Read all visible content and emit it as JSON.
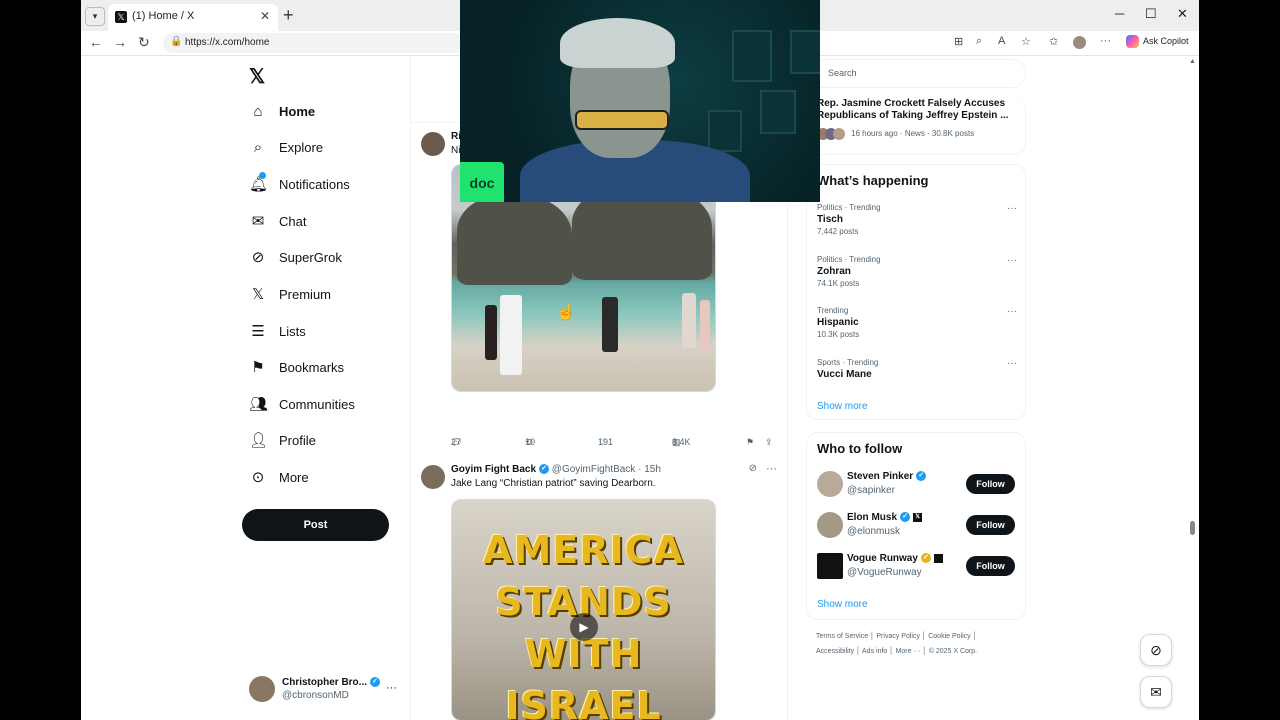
{
  "browser": {
    "tab_title": "(1) Home / X",
    "url": "https://x.com/home",
    "copilot_label": "Ask Copilot"
  },
  "nav": {
    "items": [
      {
        "label": "Home",
        "icon": "home-icon"
      },
      {
        "label": "Explore",
        "icon": "search-icon"
      },
      {
        "label": "Notifications",
        "icon": "bell-icon"
      },
      {
        "label": "Chat",
        "icon": "mail-icon"
      },
      {
        "label": "SuperGrok",
        "icon": "grok-icon"
      },
      {
        "label": "Premium",
        "icon": "x-icon"
      },
      {
        "label": "Lists",
        "icon": "list-icon"
      },
      {
        "label": "Bookmarks",
        "icon": "bookmark-icon"
      },
      {
        "label": "Communities",
        "icon": "people-icon"
      },
      {
        "label": "Profile",
        "icon": "person-icon"
      },
      {
        "label": "More",
        "icon": "more-circle-icon"
      }
    ],
    "post_label": "Post",
    "account": {
      "name": "Christopher Bro...",
      "handle": "@cbronsonMD"
    }
  },
  "feed": {
    "post1": {
      "name_prefix": "Ri",
      "text_prefix": "Ni",
      "replies": "27",
      "reposts": "10",
      "likes": "191",
      "views": "8.4K"
    },
    "post2": {
      "name": "Goyim Fight Back",
      "handle": "@GoyimFightBack · 15h",
      "text": "Jake Lang “Christian patriot” saving Dearborn.",
      "image_lines": [
        "AMERICA",
        "STANDS",
        "WITH",
        "ISRAEL"
      ]
    }
  },
  "right": {
    "search_placeholder": "Search",
    "news": {
      "headline": "Rep. Jasmine Crockett Falsely Accuses Republicans of Taking Jeffrey Epstein ...",
      "meta": "16 hours ago · News · 30.8K posts"
    },
    "happening": {
      "title": "What’s happening",
      "trends": [
        {
          "context": "Politics · Trending",
          "name": "Tisch",
          "posts": "7,442 posts"
        },
        {
          "context": "Politics · Trending",
          "name": "Zohran",
          "posts": "74.1K posts"
        },
        {
          "context": "Trending",
          "name": "Hispanic",
          "posts": "10.3K posts"
        },
        {
          "context": "Sports · Trending",
          "name": "Vucci Mane",
          "posts": ""
        }
      ],
      "show_more": "Show more"
    },
    "who_to_follow": {
      "title": "Who to follow",
      "accounts": [
        {
          "name": "Steven Pinker",
          "handle": "@sapinker",
          "button": "Follow"
        },
        {
          "name": "Elon Musk",
          "handle": "@elonmusk",
          "button": "Follow"
        },
        {
          "name": "Vogue Runway",
          "handle": "@VogueRunway",
          "button": "Follow"
        }
      ],
      "show_more": "Show more"
    },
    "footer": {
      "line1": [
        "Terms of Service",
        "Privacy Policy",
        "Cookie Policy"
      ],
      "line2": [
        "Accessibility",
        "Ads info",
        "More ···",
        "© 2025 X Corp."
      ]
    }
  },
  "overlay": {
    "doc_label": "doc"
  },
  "colors": {
    "accent": "#1d9bf0",
    "text": "#0f1419",
    "muted": "#536471",
    "doc_green": "#20e36e"
  }
}
